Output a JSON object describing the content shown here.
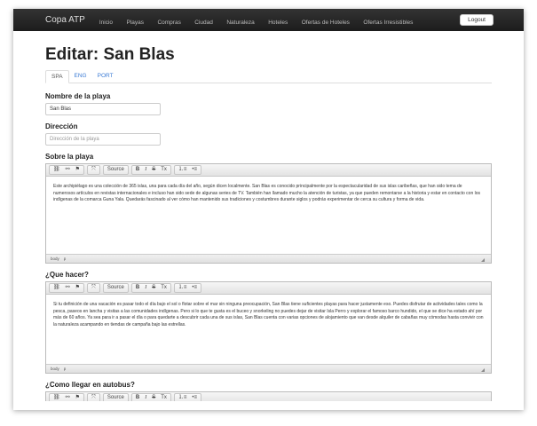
{
  "navbar": {
    "brand": "Copa ATP",
    "items": [
      "Inicio",
      "Playas",
      "Compras",
      "Ciudad",
      "Naturaleza",
      "Hoteles",
      "Ofertas de Hoteles",
      "Ofertas Irresistibles"
    ],
    "logout": "Logout"
  },
  "page": {
    "title": "Editar: San Blas",
    "tabs": [
      "SPA",
      "ENG",
      "PORT"
    ]
  },
  "fields": {
    "name_label": "Nombre de la playa",
    "name_value": "San Blas",
    "address_label": "Dirección",
    "address_placeholder": "Dirección de la playa",
    "about_label": "Sobre la playa",
    "about_text": "Este archipiélago es una colección de 365 islas, una para cada día del año, según dicen localmente. San Blas es conocido principalmente por la espectacularidad de sus islas caribeñas, que han sido tema de numerosos artículos en revistas internacionales e incluso han sido sede de algunas series de TV. También han llamado mucho la atención de turistas, ya que pueden remontarse a la historia y estar en contacto con los indígenas de la comarca Guna Yala. Quedarás fascinado al ver cómo han mantenido sus tradiciones y costumbres durante siglos y podrás experimentar de cerca su cultura y forma de vida.",
    "todo_label": "¿Que hacer?",
    "todo_text": "Si tu definición de una vacación es pasar todo el día bajo el sol o flotar sobre el mar sin ninguna preocupación, San Blas tiene suficientes playas para hacer justamente eso. Puedes disfrutar de actividades tales como la pesca, paseos en lancha y visitas a las comunidades indígenas. Pero si lo que te gusta es el buceo y snorkeling no puedes dejar de visitar Isla Perro y explorar el famoso barco hundido, el que se dice ha estado ahí por más de 60 años. Ya sea para ir a pasar el día o para quedarte a descubrir cada una de sus islas, San Blas cuenta con varias opciones de alojamiento que van desde alquiler de cabañas muy cómodas hasta convivir con la naturaleza acampando en tiendas de campaña bajo las estrellas.",
    "bus_label": "¿Como llegar en autobus?"
  },
  "editor": {
    "source": "Source",
    "status_body": "body",
    "status_p": "p"
  }
}
